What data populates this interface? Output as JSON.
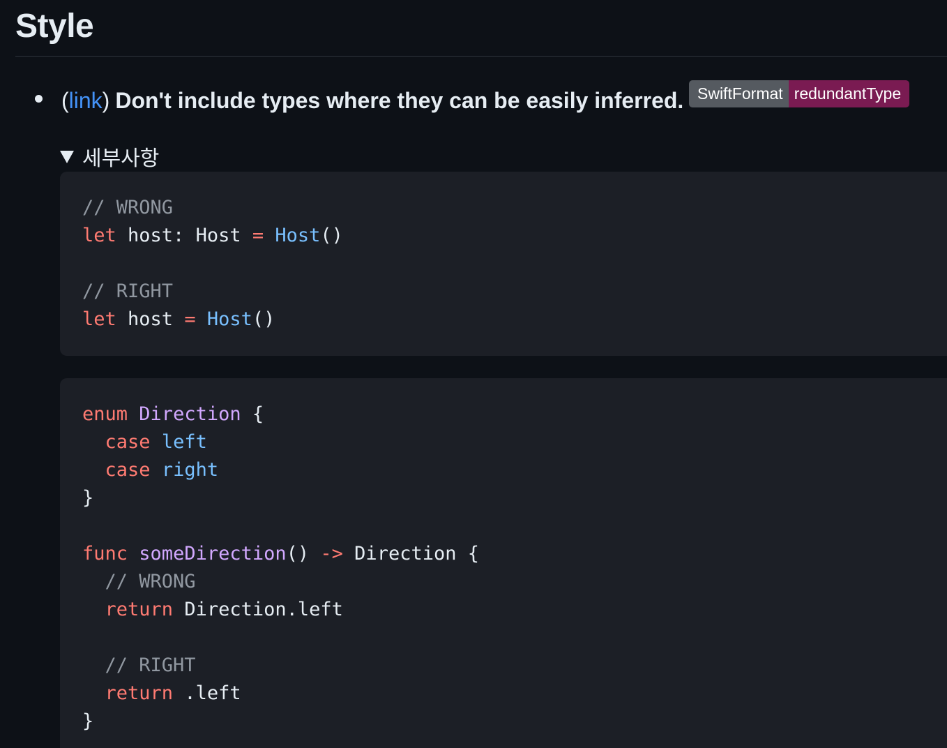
{
  "heading": "Style",
  "rule": {
    "open_paren": "(",
    "link_text": "link",
    "close_paren": ")",
    "text": "Don't include types where they can be easily inferred."
  },
  "badge": {
    "tool": "SwiftFormat",
    "rule_name": "redundantType"
  },
  "details": {
    "summary": "세부사항"
  },
  "colors": {
    "background": "#0d1117",
    "code_background": "#1c1f26",
    "link": "#4493f8",
    "keyword": "#ff7b72",
    "type": "#79c0ff",
    "entity": "#d2a8ff",
    "comment": "#9198a1",
    "badge_left": "#555a60",
    "badge_right": "#7a1b52"
  },
  "code_blocks": [
    {
      "language": "swift",
      "lines": [
        [
          {
            "t": "// WRONG",
            "k": "comment"
          }
        ],
        [
          {
            "t": "let",
            "k": "keyword"
          },
          {
            "t": " host: Host ",
            "k": "plain"
          },
          {
            "t": "=",
            "k": "keyword"
          },
          {
            "t": " ",
            "k": "plain"
          },
          {
            "t": "Host",
            "k": "type"
          },
          {
            "t": "()",
            "k": "plain"
          }
        ],
        [],
        [
          {
            "t": "// RIGHT",
            "k": "comment"
          }
        ],
        [
          {
            "t": "let",
            "k": "keyword"
          },
          {
            "t": " host ",
            "k": "plain"
          },
          {
            "t": "=",
            "k": "keyword"
          },
          {
            "t": " ",
            "k": "plain"
          },
          {
            "t": "Host",
            "k": "type"
          },
          {
            "t": "()",
            "k": "plain"
          }
        ]
      ]
    },
    {
      "language": "swift",
      "lines": [
        [
          {
            "t": "enum",
            "k": "keyword"
          },
          {
            "t": " ",
            "k": "plain"
          },
          {
            "t": "Direction",
            "k": "entity"
          },
          {
            "t": " {",
            "k": "plain"
          }
        ],
        [
          {
            "t": "  ",
            "k": "plain"
          },
          {
            "t": "case",
            "k": "keyword"
          },
          {
            "t": " ",
            "k": "plain"
          },
          {
            "t": "left",
            "k": "type"
          }
        ],
        [
          {
            "t": "  ",
            "k": "plain"
          },
          {
            "t": "case",
            "k": "keyword"
          },
          {
            "t": " ",
            "k": "plain"
          },
          {
            "t": "right",
            "k": "type"
          }
        ],
        [
          {
            "t": "}",
            "k": "plain"
          }
        ],
        [],
        [
          {
            "t": "func",
            "k": "keyword"
          },
          {
            "t": " ",
            "k": "plain"
          },
          {
            "t": "someDirection",
            "k": "entity"
          },
          {
            "t": "() ",
            "k": "plain"
          },
          {
            "t": "->",
            "k": "keyword"
          },
          {
            "t": " Direction {",
            "k": "plain"
          }
        ],
        [
          {
            "t": "  ",
            "k": "plain"
          },
          {
            "t": "// WRONG",
            "k": "comment"
          }
        ],
        [
          {
            "t": "  ",
            "k": "plain"
          },
          {
            "t": "return",
            "k": "keyword"
          },
          {
            "t": " Direction.left",
            "k": "plain"
          }
        ],
        [],
        [
          {
            "t": "  ",
            "k": "plain"
          },
          {
            "t": "// RIGHT",
            "k": "comment"
          }
        ],
        [
          {
            "t": "  ",
            "k": "plain"
          },
          {
            "t": "return",
            "k": "keyword"
          },
          {
            "t": " .left",
            "k": "plain"
          }
        ],
        [
          {
            "t": "}",
            "k": "plain"
          }
        ]
      ]
    }
  ]
}
